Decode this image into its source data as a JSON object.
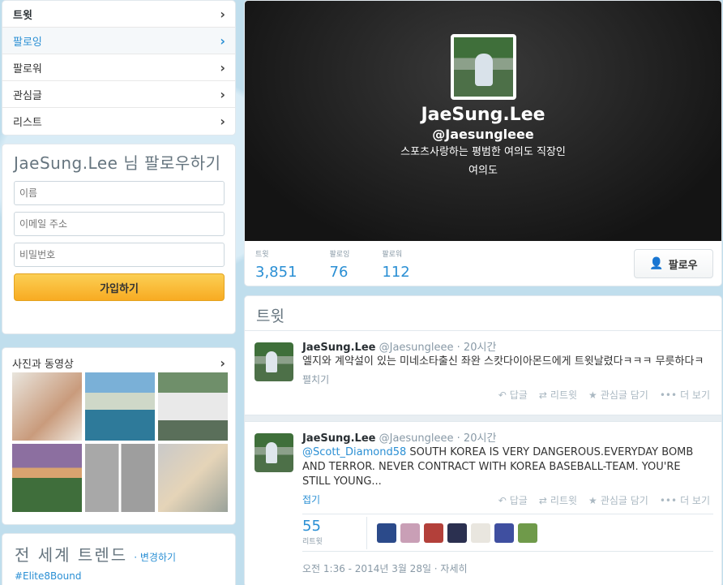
{
  "nav": {
    "items": [
      {
        "label": "트윗"
      },
      {
        "label": "팔로잉"
      },
      {
        "label": "팔로워"
      },
      {
        "label": "관심글"
      },
      {
        "label": "리스트"
      }
    ]
  },
  "signup": {
    "title": "JaeSung.Lee 님 팔로우하기",
    "name_placeholder": "이름",
    "email_placeholder": "이메일 주소",
    "password_placeholder": "비밀번호",
    "join_label": "가입하기"
  },
  "photos": {
    "title": "사진과 동영상"
  },
  "trends": {
    "title": "전 세계 트렌드",
    "change_label": "· 변경하기",
    "items": [
      "#Elite8Bound"
    ]
  },
  "profile": {
    "name": "JaeSung.Lee",
    "handle": "@Jaesungleee",
    "bio": "스포츠사랑하는 평범한 여의도 직장인",
    "location": "여의도",
    "stats": [
      {
        "label": "트윗",
        "value": "3,851"
      },
      {
        "label": "팔로잉",
        "value": "76"
      },
      {
        "label": "팔로워",
        "value": "112"
      }
    ],
    "follow_label": "팔로우"
  },
  "tweets_section": {
    "title": "트윗"
  },
  "tweets": [
    {
      "name": "JaeSung.Lee",
      "handle": "@Jaesungleee",
      "time": "· 20시간",
      "text": "엘지와 계약설이 있는 미네소타출신 좌완 스캇다이아몬드에게 트윗날렸다ㅋㅋㅋ 무릇하다ㅋ",
      "expand": "펼치기",
      "actions": {
        "reply": "답글",
        "retweet": "리트윗",
        "favorite": "관심글 담기",
        "more": "더 보기"
      }
    },
    {
      "name": "JaeSung.Lee",
      "handle": "@Jaesungleee",
      "time": "· 20시간",
      "mention": "@Scott_Diamond58",
      "text": " SOUTH KOREA IS VERY DANGEROUS.EVERYDAY BOMB AND TERROR. NEVER CONTRACT WITH KOREA BASEBALL-TEAM. YOU'RE STILL YOUNG...",
      "expand": "접기",
      "actions": {
        "reply": "답글",
        "retweet": "리트윗",
        "favorite": "관심글 담기",
        "more": "더 보기"
      },
      "retweet_count": "55",
      "retweet_label": "리트윗",
      "date": "오전 1:36 - 2014년 3월 28일 · 자세히"
    }
  ],
  "colors": {
    "accent": "#2a8fd4",
    "join_button": "#f8ab22",
    "page_bg": "#c0deed"
  }
}
